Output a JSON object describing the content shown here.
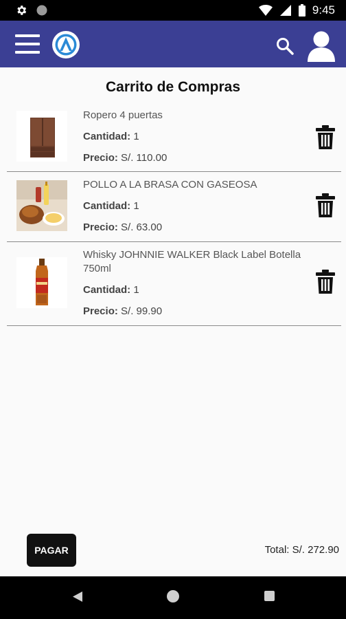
{
  "status_bar": {
    "time": "9:45"
  },
  "page": {
    "title": "Carrito de Compras"
  },
  "cart": {
    "quantity_label": "Cantidad:",
    "price_label": "Precio:",
    "items": [
      {
        "name": "Ropero 4 puertas",
        "quantity": "1",
        "price": "S/. 110.00",
        "image": "wardrobe-image"
      },
      {
        "name": "POLLO A LA BRASA CON GASEOSA",
        "quantity": "1",
        "price": "S/. 63.00",
        "image": "roast-chicken-image"
      },
      {
        "name": "Whisky JOHNNIE WALKER Black Label Botella 750ml",
        "quantity": "1",
        "price": "S/. 99.90",
        "image": "whisky-bottle-image"
      }
    ]
  },
  "footer": {
    "pay_label": "PAGAR",
    "total": "Total: S/. 272.90"
  },
  "colors": {
    "app_bar": "#3b3f94",
    "background": "#fafafa",
    "button": "#111111"
  }
}
